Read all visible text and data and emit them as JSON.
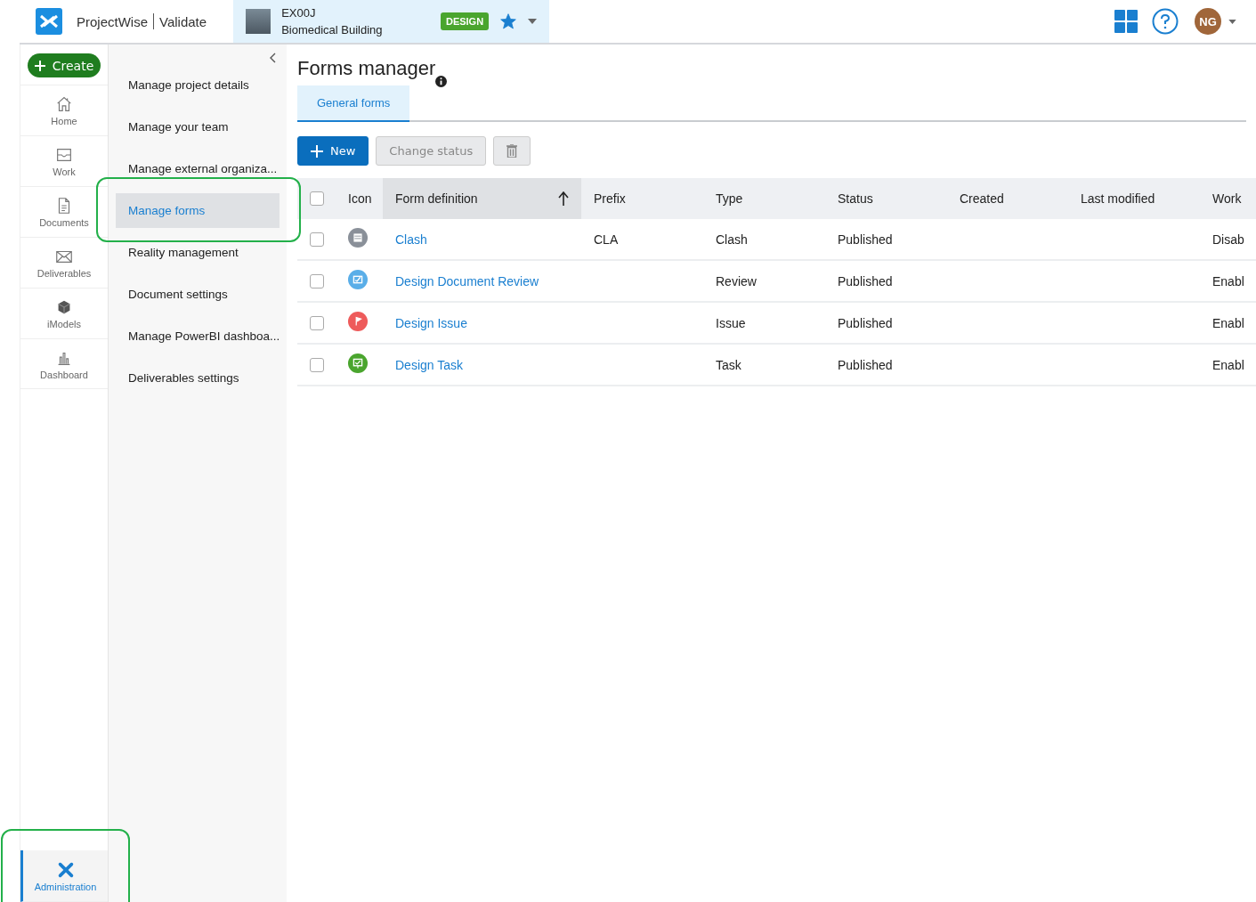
{
  "header": {
    "brand": "ProjectWise",
    "product": "Validate",
    "project": {
      "code": "EX00J",
      "name": "Biomedical Building",
      "badge": "DESIGN",
      "favorite": true
    },
    "avatar": "NG"
  },
  "nav": {
    "create": "Create",
    "items": [
      {
        "label": "Home",
        "selected": false
      },
      {
        "label": "Work",
        "selected": false
      },
      {
        "label": "Documents",
        "selected": false
      },
      {
        "label": "Deliverables",
        "selected": false
      },
      {
        "label": "iModels",
        "selected": false
      },
      {
        "label": "Dashboard",
        "selected": false
      }
    ],
    "admin": {
      "label": "Administration",
      "selected": true,
      "highlighted": true
    }
  },
  "admin_menu": [
    {
      "label": "Manage project details",
      "selected": false,
      "highlighted": false
    },
    {
      "label": "Manage your team",
      "selected": false,
      "highlighted": false
    },
    {
      "label": "Manage external organiza...",
      "selected": false,
      "highlighted": false
    },
    {
      "label": "Manage forms",
      "selected": true,
      "highlighted": true
    },
    {
      "label": "Reality management",
      "selected": false,
      "highlighted": false
    },
    {
      "label": "Document settings",
      "selected": false,
      "highlighted": false
    },
    {
      "label": "Manage PowerBI dashboa...",
      "selected": false,
      "highlighted": false
    },
    {
      "label": "Deliverables settings",
      "selected": false,
      "highlighted": false
    }
  ],
  "page": {
    "title": "Forms manager",
    "tabs": [
      {
        "label": "General forms",
        "selected": true
      }
    ],
    "toolbar": {
      "new": "New",
      "change_status": "Change status"
    },
    "table": {
      "all_checked": false,
      "columns": [
        "Icon",
        "Form definition",
        "Prefix",
        "Type",
        "Status",
        "Created",
        "Last modified",
        "Work"
      ],
      "rows": [
        {
          "checked": false,
          "color": "#8a9099",
          "name": "Clash",
          "prefix": "CLA",
          "type": "Clash",
          "status": "Published",
          "column_8": "Disab"
        },
        {
          "checked": false,
          "color": "#5aaee8",
          "name": "Design Document Review",
          "type": "Review",
          "status": "Published",
          "column_8": "Enabl"
        },
        {
          "checked": false,
          "color": "#ee5b5b",
          "name": "Design Issue",
          "type": "Issue",
          "status": "Published",
          "column_8": "Enabl"
        },
        {
          "checked": false,
          "color": "#4aa52e",
          "name": "Design Task",
          "type": "Task",
          "status": "Published",
          "column_8": "Enabl"
        }
      ]
    }
  }
}
